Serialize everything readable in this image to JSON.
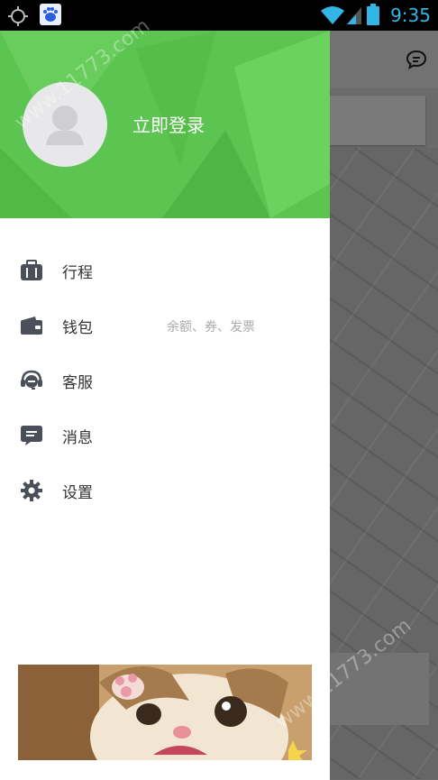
{
  "status_bar": {
    "time": "9:35"
  },
  "drawer": {
    "login_label": "立即登录",
    "menu": [
      {
        "id": "trips",
        "label": "行程",
        "icon": "suitcase-icon"
      },
      {
        "id": "wallet",
        "label": "钱包",
        "sub": "余额、券、发票",
        "icon": "wallet-icon"
      },
      {
        "id": "service",
        "label": "客服",
        "icon": "headset-icon"
      },
      {
        "id": "messages",
        "label": "消息",
        "icon": "message-icon"
      },
      {
        "id": "settings",
        "label": "设置",
        "icon": "gear-icon"
      }
    ]
  },
  "watermark": "www.11773.com",
  "colors": {
    "header_green": "#5cc451",
    "icon_gray": "#4a4f5a"
  }
}
